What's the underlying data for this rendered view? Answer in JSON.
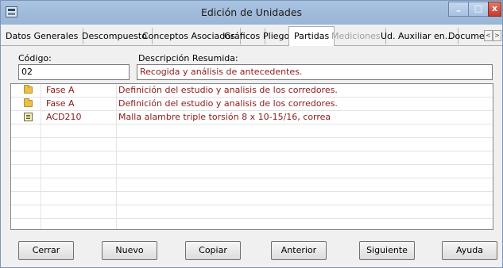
{
  "window": {
    "title": "Edición de Unidades"
  },
  "controls": {
    "minimize": "–",
    "maximize": "□",
    "close": "x"
  },
  "tabs": [
    {
      "label": "Datos Generales",
      "state": "normal"
    },
    {
      "label": "Descompuesto",
      "state": "normal"
    },
    {
      "label": "Conceptos Asociados",
      "state": "normal"
    },
    {
      "label": "Gráficos",
      "state": "normal"
    },
    {
      "label": "Pliego",
      "state": "normal"
    },
    {
      "label": "Partidas",
      "state": "active"
    },
    {
      "label": "Mediciones",
      "state": "disabled"
    },
    {
      "label": "Ud. Auxiliar en...",
      "state": "normal"
    },
    {
      "label": "Documento",
      "state": "normal"
    }
  ],
  "tab_scroll": {
    "left": "<",
    "right": ">"
  },
  "form": {
    "code_label": "Código:",
    "desc_label": "Descripción Resumida:",
    "code_value": "02",
    "desc_value": "Recogida y análisis de antecedentes."
  },
  "rows": [
    {
      "icon": "folder-icon",
      "code": "Fase A",
      "description": "Definición del estudio y analisis de los corredores."
    },
    {
      "icon": "folder-icon",
      "code": "Fase A",
      "description": "Definición del estudio y analisis de los corredores."
    },
    {
      "icon": "item-icon",
      "code": "ACD210",
      "description": "Malla alambre triple torsión 8 x 10-15/16, correa"
    }
  ],
  "buttons": {
    "cerrar": "Cerrar",
    "nuevo": "Nuevo",
    "copiar": "Copiar",
    "anterior": "Anterior",
    "siguiente": "Siguiente",
    "ayuda": "Ayuda"
  },
  "colors": {
    "text_red": "#8b1a1a",
    "title_bar": "#a9c3e2"
  }
}
